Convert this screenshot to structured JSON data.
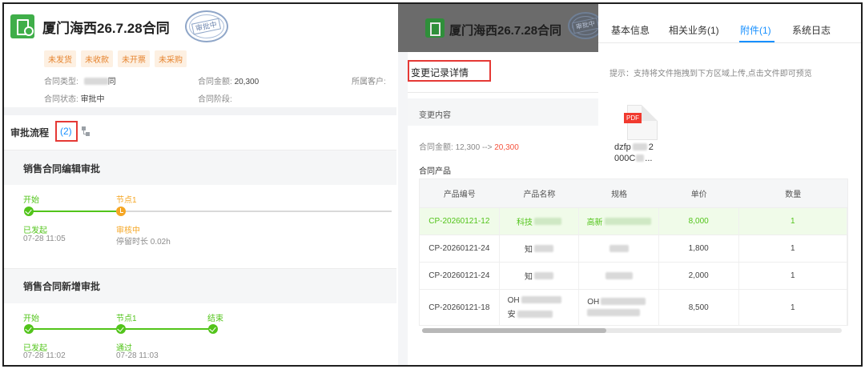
{
  "left": {
    "title": "厦门海西26.7.28合同",
    "seal_text": "审批中",
    "tags": [
      "未发货",
      "未收款",
      "未开票",
      "未采购"
    ],
    "meta": {
      "contract_type_label": "合同类型:",
      "contract_type_value": "同",
      "amount_label": "合同金额:",
      "amount_value": "20,300",
      "customer_label": "所属客户:",
      "status_label": "合同状态:",
      "status_value": "审批中",
      "stage_label": "合同阶段:"
    },
    "flow_title": "审批流程",
    "flow_count": "(2)",
    "flows": [
      {
        "title": "销售合同编辑审批",
        "nodes": [
          {
            "label": "开始",
            "state": "已发起",
            "time": "07-28 11:05"
          },
          {
            "label": "节点1",
            "state": "审核中",
            "time": "停留时长 0.02h"
          }
        ]
      },
      {
        "title": "销售合同新增审批",
        "nodes": [
          {
            "label": "开始",
            "state": "已发起",
            "time": "07-28 11:02"
          },
          {
            "label": "节点1",
            "state": "通过",
            "time": "07-28 11:03"
          },
          {
            "label": "结束"
          }
        ]
      }
    ]
  },
  "right": {
    "title": "厦门海西26.7.28合同",
    "tabs": [
      "基本信息",
      "相关业务(1)",
      "附件(1)",
      "系统日志"
    ],
    "active_tab": "附件(1)",
    "hint": "提示：支持将文件拖拽到下方区域上传,点击文件即可预览",
    "attachment": {
      "badge": "PDF",
      "name_line1": "dzfp",
      "name_line1_end": "2",
      "name_line2": "000C",
      "name_line2_end": "..."
    },
    "panel": {
      "title": "变更记录详情",
      "section": "变更内容",
      "change_label": "合同金额:",
      "change_old": "12,300",
      "change_arrow": "-->",
      "change_new": "20,300",
      "products_label": "合同产品"
    },
    "table": {
      "headers": [
        "产品编号",
        "产品名称",
        "规格",
        "单价",
        "数量"
      ],
      "rows": [
        {
          "code": "CP-20260121-12",
          "name": "科技",
          "name_end": "",
          "spec": "高新",
          "price": "8,000",
          "qty": "1",
          "highlight": true
        },
        {
          "code": "CP-20260121-24",
          "name": "知",
          "spec": "",
          "price": "1,800",
          "qty": "1"
        },
        {
          "code": "CP-20260121-24",
          "name": "知",
          "spec": "",
          "price": "2,000",
          "qty": "1"
        },
        {
          "code": "CP-20260121-18",
          "name": "OH",
          "name2": "安",
          "spec": "OH",
          "price": "8,500",
          "qty": "1"
        }
      ]
    }
  },
  "colors": {
    "accent": "#1890ff",
    "success": "#52c41a",
    "warning": "#f5a623",
    "danger": "#e53935",
    "tag_text": "#e6842f"
  }
}
